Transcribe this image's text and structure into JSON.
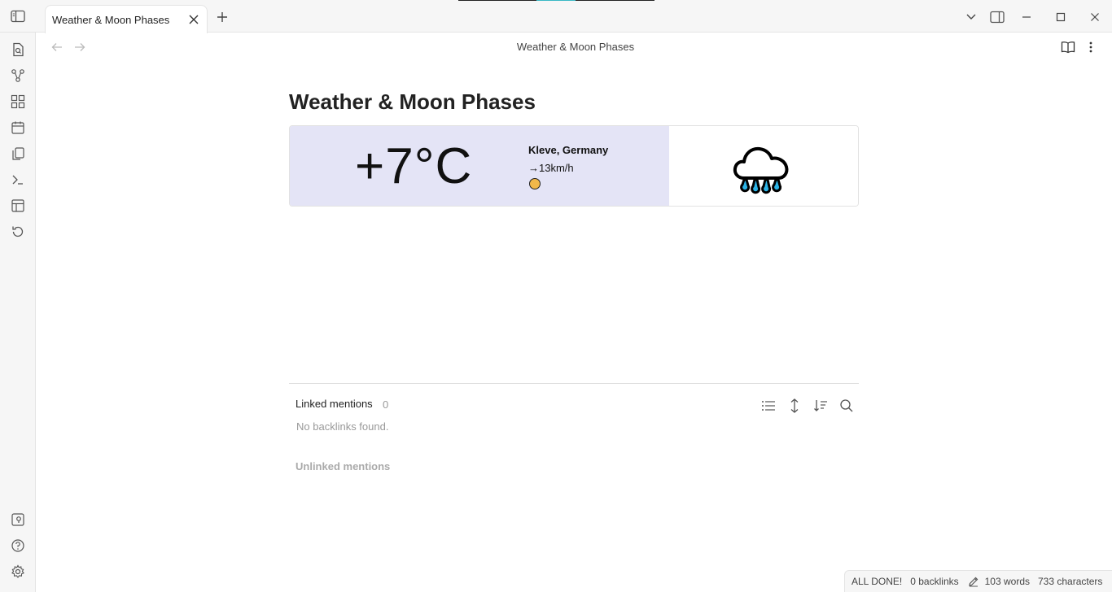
{
  "tab": {
    "title": "Weather & Moon Phases"
  },
  "view": {
    "title": "Weather & Moon Phases"
  },
  "note": {
    "title": "Weather & Moon Phases",
    "weather": {
      "temperature": "+7°C",
      "location": "Kleve, Germany",
      "wind": "→13km/h",
      "condition_icon": "rain-cloud-icon",
      "moon_icon": "moon-phase-icon"
    }
  },
  "backlinks": {
    "linked_label": "Linked mentions",
    "linked_count": "0",
    "no_backlinks": "No backlinks found.",
    "unlinked_label": "Unlinked mentions"
  },
  "statusbar": {
    "status": "ALL DONE!",
    "backlinks": "0 backlinks",
    "words": "103 words",
    "characters": "733 characters"
  },
  "colors": {
    "weather_left_bg": "#e4e4f6",
    "moon": "#f2b84a",
    "rain_drops": "#2bb3e6",
    "accent": "#39b8c4"
  }
}
